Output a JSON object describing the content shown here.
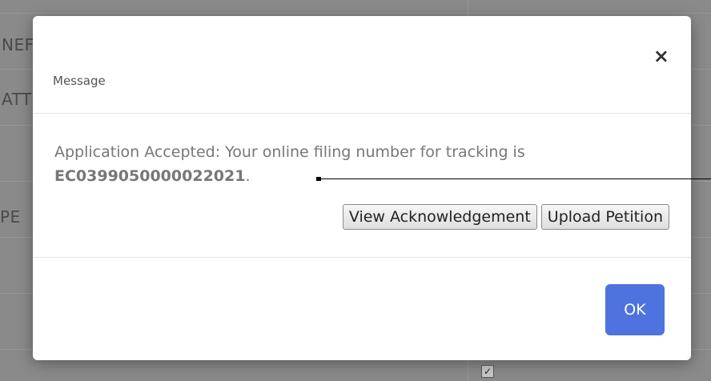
{
  "background": {
    "peek_labels": [
      "NEF",
      "ATT",
      "PE"
    ],
    "checkbox_glyph": "✓"
  },
  "dialog": {
    "title": "Message",
    "close_glyph": "×",
    "message_prefix": "Application Accepted: Your online filing number for tracking is",
    "filing_number": "EC0399050000022021",
    "message_suffix": ".",
    "buttons": {
      "view_ack": "View Acknowledgement",
      "upload_petition": "Upload Petition"
    },
    "ok_label": "OK"
  },
  "colors": {
    "overlay": "#8a8a8a",
    "ok_button": "#4e73df",
    "message_text": "#777777"
  }
}
